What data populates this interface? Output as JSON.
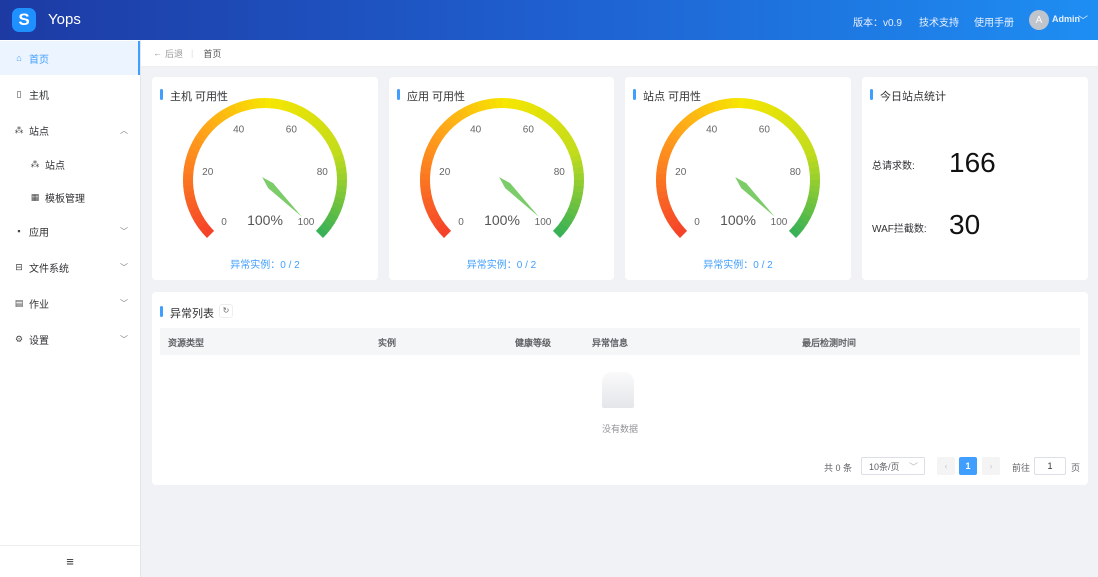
{
  "header": {
    "app_name": "Yops",
    "logo_glyph": "S",
    "version": "版本：v0.9",
    "support": "技术支持",
    "manual": "使用手册",
    "avatar_letter": "A",
    "user": "Admin"
  },
  "sidebar": {
    "items": [
      {
        "label": "首页",
        "icon": "home-icon"
      },
      {
        "label": "主机",
        "icon": "server-icon"
      },
      {
        "label": "站点",
        "icon": "sitemap-icon"
      },
      {
        "label": "站点",
        "icon": "sitemap-icon"
      },
      {
        "label": "模板管理",
        "icon": "template-icon"
      },
      {
        "label": "应用",
        "icon": "apps-icon"
      },
      {
        "label": "文件系统",
        "icon": "storage-icon"
      },
      {
        "label": "作业",
        "icon": "job-icon"
      },
      {
        "label": "设置",
        "icon": "gear-icon"
      }
    ],
    "collapse_icon": "menu-icon"
  },
  "breadcrumb": {
    "back": "后退",
    "current": "首页"
  },
  "gauges": [
    {
      "title": "主机 可用性",
      "value": 100,
      "display": "100%",
      "abnormal": "异常实例：0 / 2"
    },
    {
      "title": "应用 可用性",
      "value": 100,
      "display": "100%",
      "abnormal": "异常实例：0 / 2"
    },
    {
      "title": "站点 可用性",
      "value": 100,
      "display": "100%",
      "abnormal": "异常实例：0 / 2"
    }
  ],
  "gauge_ticks": [
    "0",
    "20",
    "40",
    "60",
    "80",
    "100"
  ],
  "stats": {
    "title": "今日站点统计",
    "requests_label": "总请求数:",
    "requests": "166",
    "waf_label": "WAF拦截数:",
    "waf": "30"
  },
  "table": {
    "title": "异常列表",
    "columns": [
      "资源类型",
      "实例",
      "健康等级",
      "异常信息",
      "最后检测时间"
    ],
    "empty": "没有数据"
  },
  "pagination": {
    "total": "共 0 条",
    "page_size": "10条/页",
    "current": "1",
    "goto": "前往",
    "goto_value": "1",
    "page_unit": "页"
  }
}
